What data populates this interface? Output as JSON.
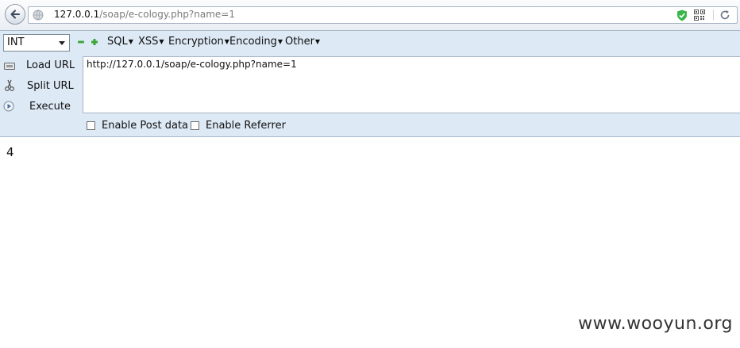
{
  "navbar": {
    "url_host": "127.0.0.1",
    "url_path": "/soap/e-cology.php?name=1",
    "icons": [
      "back-arrow-icon",
      "globe-icon",
      "shield-check-icon",
      "qr-code-icon",
      "reload-icon"
    ]
  },
  "hackbar": {
    "select_value": "INT",
    "menus": [
      {
        "label": "SQL"
      },
      {
        "label": "XSS"
      },
      {
        "label": "Encryption"
      },
      {
        "label": "Encoding"
      },
      {
        "label": "Other"
      }
    ],
    "actions": {
      "load_url": "Load URL",
      "split_url": "Split URL",
      "execute": "Execute"
    },
    "url_value": "http://127.0.0.1/soap/e-cology.php?name=1",
    "enable_post": "Enable Post data",
    "enable_referrer": "Enable Referrer"
  },
  "page": {
    "result": "4",
    "watermark": "www.wooyun.org"
  },
  "colors": {
    "hackbar_bg": "#dde9f5",
    "plus_minus_green": "#3aa63a",
    "shield_green": "#3bb54a"
  }
}
